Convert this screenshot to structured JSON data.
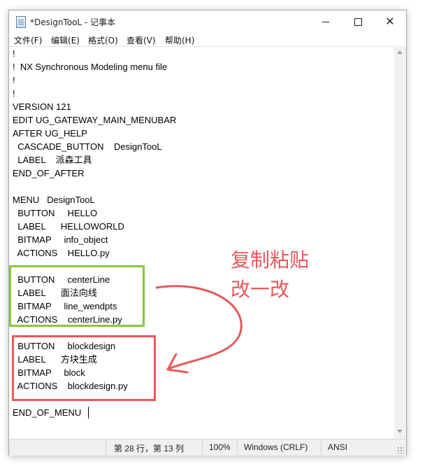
{
  "window": {
    "title": "*DesignTooL - 记事本"
  },
  "menubar": {
    "items": [
      "文件(F)",
      "编辑(E)",
      "格式(O)",
      "查看(V)",
      "帮助(H)"
    ]
  },
  "editor": {
    "lines": [
      "!",
      "!  NX Synchronous Modeling menu file",
      "!",
      "!",
      "VERSION 121",
      "EDIT UG_GATEWAY_MAIN_MENUBAR",
      "AFTER UG_HELP",
      "  CASCADE_BUTTON    DesignTooL",
      "  LABEL    派森工具",
      "END_OF_AFTER",
      "",
      "MENU   DesignTooL",
      "  BUTTON     HELLO",
      "  LABEL      HELLOWORLD",
      "  BITMAP     info_object",
      "  ACTIONS    HELLO.py",
      "",
      "  BUTTON     centerLine",
      "  LABEL      面法向线",
      "  BITMAP     line_wendpts",
      "  ACTIONS    centerLine.py",
      "",
      "  BUTTON     blockdesign",
      "  LABEL      方块生成",
      "  BITMAP     block",
      "  ACTIONS    blockdesign.py",
      "",
      "END_OF_MENU"
    ]
  },
  "statusbar": {
    "position": "第 28 行，第 13 列",
    "zoom": "100%",
    "line_ending": "Windows (CRLF)",
    "encoding": "ANSI"
  },
  "annotation": {
    "line1": "复制粘贴",
    "line2": "改一改"
  },
  "colors": {
    "highlight_green": "#8cc63f",
    "highlight_red": "#e8585b",
    "annotation_red": "#e8585b"
  }
}
